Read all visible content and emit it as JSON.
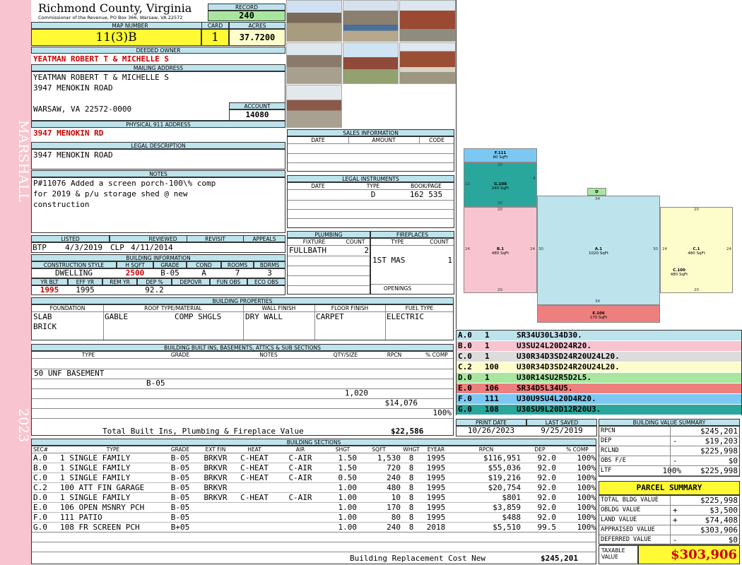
{
  "side": {
    "district": "MARSHALL",
    "year": "2023"
  },
  "header": {
    "county": "Richmond County, Virginia",
    "commissioner": "Commissioner of the Revenue, PO Box 366, Warsaw, VA 22572",
    "record_label": "RECORD",
    "record": "240",
    "map_label": "MAP NUMBER",
    "map": "11(3)B",
    "card_label": "CARD",
    "card": "1",
    "acres_label": "ACRES",
    "acres": "37.7200"
  },
  "owner": {
    "deeded_label": "DEEDED OWNER",
    "deeded": "YEATMAN ROBERT T & MICHELLE S",
    "mailing_label": "MAILING ADDRESS",
    "mailing_lines": [
      "YEATMAN ROBERT T & MICHELLE S",
      "3947 MENOKIN ROAD",
      "",
      "WARSAW, VA 22572-0000"
    ],
    "account_label": "ACCOUNT",
    "account": "14080",
    "physical_label": "PHYSICAL 911 ADDRESS",
    "physical": "3947 MENOKIN RD",
    "legal_label": "LEGAL DESCRIPTION",
    "legal": "3947 MENOKIN ROAD",
    "notes_label": "NOTES",
    "notes_lines": [
      "P#11076 Added a screen porch-100\\% comp",
      "for 2019 & p/u storage shed @ new",
      "construction"
    ]
  },
  "sales": {
    "title": "SALES INFORMATION",
    "cols": [
      "DATE",
      "AMOUNT",
      "CODE"
    ]
  },
  "legal_instruments": {
    "title": "LEGAL INSTRUMENTS",
    "cols": [
      "DATE",
      "TYPE",
      "BOOK/PAGE"
    ],
    "type": "D",
    "bookpage": "162 535"
  },
  "review": {
    "labels": [
      "LISTED",
      "REVIEWED",
      "REVISIT",
      "APPEALS"
    ],
    "listed_by": "BTP",
    "listed_date": "4/3/2019",
    "reviewed_by": "CLP",
    "reviewed_date": "4/11/2014"
  },
  "building_info": {
    "title": "BUILDING INFORMATION",
    "labels": [
      "CONSTRUCTION STYLE",
      "H SQFT",
      "GRADE",
      "COND",
      "ROOMS",
      "BDRMS"
    ],
    "style": "DWELLING",
    "hsqft": "2500",
    "grade": "B-05",
    "cond": "A",
    "rooms": "7",
    "bdrms": "3",
    "labels2": [
      "YR BLT",
      "EFF YR",
      "REM YR",
      "DEP %",
      "DEPOVR",
      "FUN OBS",
      "ECO OBS"
    ],
    "yrblt": "1995",
    "effyr": "1995",
    "dep": "92.2"
  },
  "plumbing": {
    "title": "PLUMBING",
    "cols": [
      "FIXTURE",
      "COUNT"
    ],
    "fixture": "FULLBATH",
    "count": "2"
  },
  "fireplaces": {
    "title": "FIREPLACES",
    "cols": [
      "TYPE",
      "COUNT"
    ],
    "type": "1ST MAS",
    "count": "1",
    "openings": "OPENINGS"
  },
  "properties": {
    "title": "BUILDING PROPERTIES",
    "labels": [
      "FOUNDATION",
      "ROOF TYPE/MATERIAL",
      "WALL FINISH",
      "FLOOR FINISH",
      "FUEL TYPE"
    ],
    "foundation": [
      "SLAB",
      "BRICK"
    ],
    "roof_type": "GABLE",
    "roof_mat": "COMP SHGLS",
    "wall": "DRY WALL",
    "floor": "CARPET",
    "fuel": "ELECTRIC"
  },
  "builtins": {
    "title": "BUILDING BUILT INS, BASEMENTS, ATTICS & SUB SECTIONS",
    "cols": [
      "TYPE",
      "GRADE",
      "NOTES",
      "QTY/SIZE",
      "RPCN",
      "% COMP"
    ],
    "row": {
      "type": "50 UNF BASEMENT",
      "grade": "B-05",
      "qty": "1,020",
      "rpcn": "$14,076",
      "comp": "100%"
    },
    "total_label": "Total Built Ins, Plumbing & Fireplace Value",
    "total": "$22,586"
  },
  "sections": {
    "title": "BUILDING SECTIONS",
    "cols": [
      "SEC#",
      "TYPE",
      "GRADE",
      "EXT FIN",
      "HEAT",
      "AIR",
      "SHGT",
      "SQFT",
      "WHGT",
      "EYEAR",
      "RPCN",
      "DEP",
      "% COMP"
    ],
    "rows": [
      {
        "sec": "A.0",
        "type": "1 SINGLE FAMILY",
        "grade": "B-05",
        "ext": "BRKVR",
        "heat": "C-HEAT",
        "air": "C-AIR",
        "shgt": "1.50",
        "sqft": "1,530",
        "whgt": "8",
        "eyear": "1995",
        "rpcn": "$116,951",
        "dep": "92.0",
        "comp": "100%"
      },
      {
        "sec": "B.0",
        "type": "1 SINGLE FAMILY",
        "grade": "B-05",
        "ext": "BRKVR",
        "heat": "C-HEAT",
        "air": "C-AIR",
        "shgt": "1.50",
        "sqft": "720",
        "whgt": "8",
        "eyear": "1995",
        "rpcn": "$55,036",
        "dep": "92.0",
        "comp": "100%"
      },
      {
        "sec": "C.0",
        "type": "1 SINGLE FAMILY",
        "grade": "B-05",
        "ext": "BRKVR",
        "heat": "C-HEAT",
        "air": "C-AIR",
        "shgt": "0.50",
        "sqft": "240",
        "whgt": "8",
        "eyear": "1995",
        "rpcn": "$19,216",
        "dep": "92.0",
        "comp": "100%"
      },
      {
        "sec": "C.2",
        "type": "100 ATT FIN GARAGE",
        "grade": "B-05",
        "ext": "BRKVR",
        "heat": "",
        "air": "",
        "shgt": "1.00",
        "sqft": "480",
        "whgt": "8",
        "eyear": "1995",
        "rpcn": "$20,754",
        "dep": "92.0",
        "comp": "100%"
      },
      {
        "sec": "D.0",
        "type": "1 SINGLE FAMILY",
        "grade": "B-05",
        "ext": "BRKVR",
        "heat": "C-HEAT",
        "air": "C-AIR",
        "shgt": "1.00",
        "sqft": "10",
        "whgt": "8",
        "eyear": "1995",
        "rpcn": "$801",
        "dep": "92.0",
        "comp": "100%"
      },
      {
        "sec": "E.0",
        "type": "106 OPEN MSNRY PCH",
        "grade": "B-05",
        "ext": "",
        "heat": "",
        "air": "",
        "shgt": "1.00",
        "sqft": "170",
        "whgt": "8",
        "eyear": "1995",
        "rpcn": "$3,859",
        "dep": "92.0",
        "comp": "100%"
      },
      {
        "sec": "F.0",
        "type": "111 PATIO",
        "grade": "B-05",
        "ext": "",
        "heat": "",
        "air": "",
        "shgt": "1.00",
        "sqft": "80",
        "whgt": "8",
        "eyear": "1995",
        "rpcn": "$488",
        "dep": "92.0",
        "comp": "100%"
      },
      {
        "sec": "G.0",
        "type": "108 FR SCREEN PCH",
        "grade": "B+05",
        "ext": "",
        "heat": "",
        "air": "",
        "shgt": "1.00",
        "sqft": "240",
        "whgt": "8",
        "eyear": "2018",
        "rpcn": "$5,510",
        "dep": "99.5",
        "comp": "100%"
      }
    ],
    "brcn_label": "Building Replacement Cost New",
    "brcn": "$245,201"
  },
  "sketch_codes": [
    {
      "sec": "A.0",
      "code": "1",
      "path": "SR34U30L34D30.",
      "color": "#bde3ec"
    },
    {
      "sec": "B.0",
      "code": "1",
      "path": "U3SU24L20D24R20.",
      "color": "#f7c4cf"
    },
    {
      "sec": "C.0",
      "code": "1",
      "path": "U30R34D3SD24R20U24L20.",
      "color": "#dcdcdc"
    },
    {
      "sec": "C.2",
      "code": "100",
      "path": "U30R34D3SD24R20U24L20.",
      "color": "#fdfccb"
    },
    {
      "sec": "D.0",
      "code": "1",
      "path": "U30R14SU2R5D2L5.",
      "color": "#a8e6a0"
    },
    {
      "sec": "E.0",
      "code": "106",
      "path": "SR34D5L34U5.",
      "color": "#ee7f7f"
    },
    {
      "sec": "F.0",
      "code": "111",
      "path": "U30U9SU4L20D4R20.",
      "color": "#7cc8f2"
    },
    {
      "sec": "G.0",
      "code": "108",
      "path": "U30SU9L20D12R20U3.",
      "color": "#2aa79c"
    }
  ],
  "sketch": {
    "F": {
      "label": "F.111",
      "area": "80 SqFt"
    },
    "G": {
      "label": "G.108",
      "area": "240 SqFt"
    },
    "B": {
      "label": "B.1",
      "area": "480 SqFt"
    },
    "A": {
      "label": "A.1",
      "area": "1020 SqFt"
    },
    "C": {
      "label": "C.1",
      "area": "480 SqFt"
    },
    "C2": {
      "label": "C.100",
      "area": "480 SqFt"
    },
    "D": {
      "label": "D"
    },
    "E": {
      "label": "E.106",
      "area": "170 SqFt"
    },
    "dims": {
      "d20": "20",
      "d24": "24",
      "d30": "30",
      "d34": "34",
      "d12": "12",
      "d4": "4"
    }
  },
  "dates": {
    "print_label": "PRINT DATE",
    "print": "10/26/2023",
    "saved_label": "LAST SAVED",
    "saved": "9/25/2019"
  },
  "value_summary": {
    "title": "BUILDING VALUE SUMMARY",
    "rows": [
      {
        "label": "RPCN",
        "sign": "",
        "pct": "",
        "value": "$245,201"
      },
      {
        "label": "DEP",
        "sign": "-",
        "pct": "",
        "value": "$19,203"
      },
      {
        "label": "RCLND",
        "sign": "",
        "pct": "",
        "value": "$225,998"
      },
      {
        "label": "OBS F/E",
        "sign": "-",
        "pct": "",
        "value": "$0"
      },
      {
        "label": "LTF",
        "sign": "",
        "pct": "100%",
        "value": "$225,998"
      }
    ]
  },
  "parcel": {
    "title": "PARCEL SUMMARY",
    "rows": [
      {
        "label": "TOTAL BLDG VALUE",
        "sign": "",
        "value": "$225,998"
      },
      {
        "label": "OBLDG VALUE",
        "sign": "+",
        "value": "$3,500"
      },
      {
        "label": "LAND VALUE",
        "sign": "+",
        "value": "$74,408"
      },
      {
        "label": "APPRAISED VALUE",
        "sign": "",
        "value": "$303,906"
      },
      {
        "label": "DEFERRED VALUE",
        "sign": "-",
        "value": "$0"
      }
    ],
    "taxable_label": "TAXABLE VALUE",
    "taxable": "$303,906"
  }
}
